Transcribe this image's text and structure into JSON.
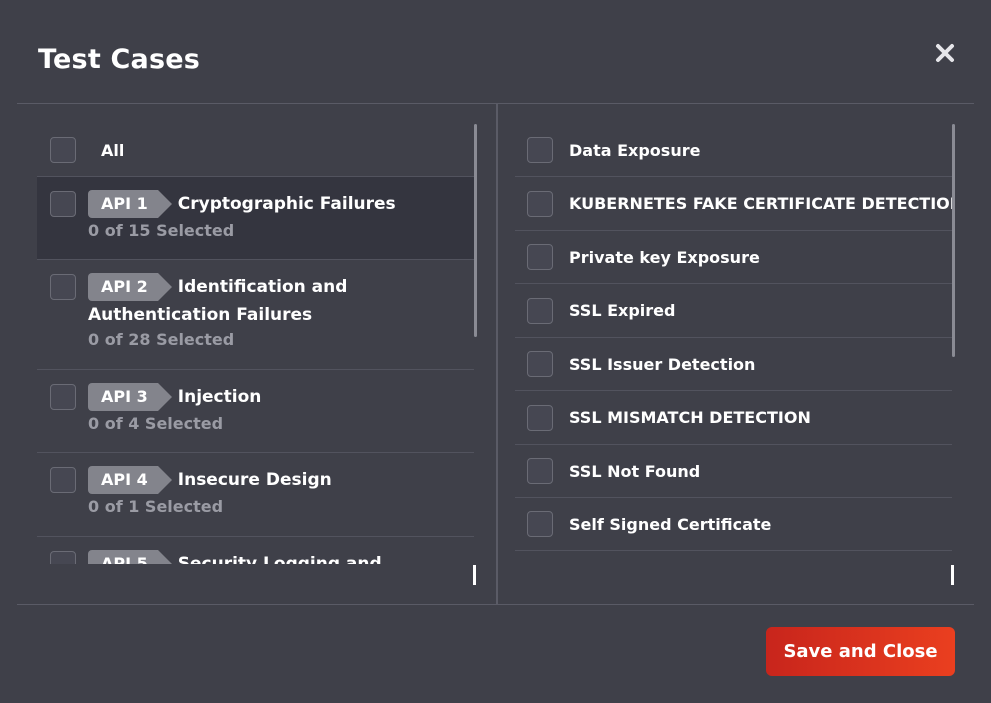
{
  "modal": {
    "title": "Test Cases",
    "save_label": "Save and Close"
  },
  "left_panel": {
    "all_label": "All",
    "items": [
      {
        "tag": "API 1",
        "title": "Cryptographic Failures",
        "title_wrap": "",
        "count": "0 of 15 Selected",
        "selected": true
      },
      {
        "tag": "API 2",
        "title": "Identification and",
        "title_wrap": "Authentication Failures",
        "count": "0 of 28 Selected",
        "selected": false
      },
      {
        "tag": "API 3",
        "title": "Injection",
        "title_wrap": "",
        "count": "0 of 4 Selected",
        "selected": false
      },
      {
        "tag": "API 4",
        "title": "Insecure Design",
        "title_wrap": "",
        "count": "0 of 1 Selected",
        "selected": false
      },
      {
        "tag": "API 5",
        "title": "Security Logging and Monitoring",
        "title_wrap": "",
        "count": "",
        "selected": false
      }
    ]
  },
  "right_panel": {
    "items": [
      "Data Exposure",
      "KUBERNETES FAKE CERTIFICATE DETECTION",
      "Private key Exposure",
      "SSL Expired",
      "SSL Issuer Detection",
      "SSL MISMATCH DETECTION",
      "SSL Not Found",
      "Self Signed Certificate"
    ]
  },
  "colors": {
    "background": "#3f4049",
    "selected_row": "#34353f",
    "tag": "#83848c",
    "accent": "#e03a1e"
  }
}
